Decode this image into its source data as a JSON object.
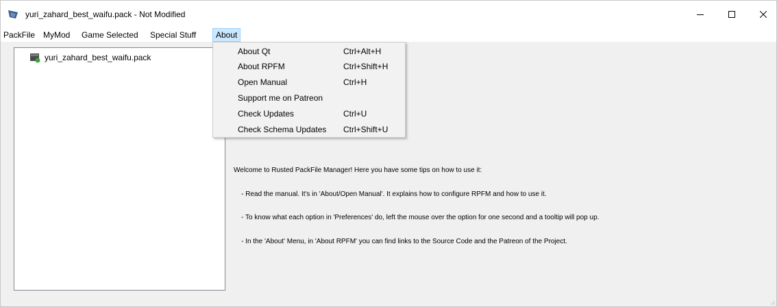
{
  "window": {
    "title": "yuri_zahard_best_waifu.pack - Not Modified",
    "controls": {
      "minimize": "minimize-icon",
      "maximize": "maximize-icon",
      "close": "close-icon"
    }
  },
  "menubar": {
    "items": [
      {
        "label": "PackFile"
      },
      {
        "label": "MyMod"
      },
      {
        "label": "Game Selected"
      },
      {
        "label": "Special Stuff"
      },
      {
        "label": "About",
        "active": true
      }
    ]
  },
  "about_menu": {
    "items": [
      {
        "label": "About Qt",
        "shortcut": "Ctrl+Alt+H"
      },
      {
        "label": "About RPFM",
        "shortcut": "Ctrl+Shift+H"
      },
      {
        "label": "Open Manual",
        "shortcut": "Ctrl+H"
      },
      {
        "label": "Support me on Patreon",
        "shortcut": ""
      },
      {
        "label": "Check Updates",
        "shortcut": "Ctrl+U"
      },
      {
        "label": "Check Schema Updates",
        "shortcut": "Ctrl+Shift+U"
      }
    ]
  },
  "tree": {
    "items": [
      {
        "label": "yuri_zahard_best_waifu.pack",
        "icon": "packfile-icon"
      }
    ]
  },
  "welcome": {
    "lines": [
      "Welcome to Rusted PackFile Manager! Here you have some tips on how to use it:",
      "    - Read the manual. It's in 'About/Open Manual'. It explains how to configure RPFM and how to use it.",
      "    - To know what each option in 'Preferences' do, left the mouse over the option for one second and a tooltip will pop up.",
      "    - In the 'About' Menu, in 'About RPFM' you can find links to the Source Code and the Patreon of the Project."
    ]
  },
  "colors": {
    "menu_active_bg": "#cce8ff",
    "menu_active_border": "#99d1ff",
    "app_icon": "#3c5a8c",
    "pack_icon_green": "#3aa63a"
  }
}
